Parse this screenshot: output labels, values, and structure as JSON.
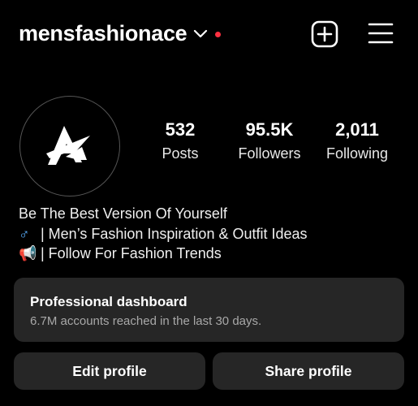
{
  "header": {
    "username": "mensfashionace",
    "icons": [
      "chevron-down-icon",
      "plus-square-icon",
      "hamburger-menu-icon"
    ],
    "notification_dot_color": "#ff3040"
  },
  "stats": {
    "posts": {
      "count": "532",
      "label": "Posts"
    },
    "followers": {
      "count": "95.5K",
      "label": "Followers"
    },
    "following": {
      "count": "2,011",
      "label": "Following"
    }
  },
  "bio": {
    "line1": "Be The Best Version Of Yourself",
    "line2_emoji": "♂",
    "line2": " | Men’s Fashion Inspiration & Outfit Ideas",
    "line3_emoji": "📢",
    "line3": " | Follow For Fashion Trends"
  },
  "dashboard": {
    "title": "Professional dashboard",
    "subtitle": "6.7M accounts reached in the last 30 days."
  },
  "buttons": {
    "edit": "Edit profile",
    "share": "Share profile"
  },
  "colors": {
    "background": "#000000",
    "card": "#262626",
    "secondary_text": "#a8a8a8"
  }
}
